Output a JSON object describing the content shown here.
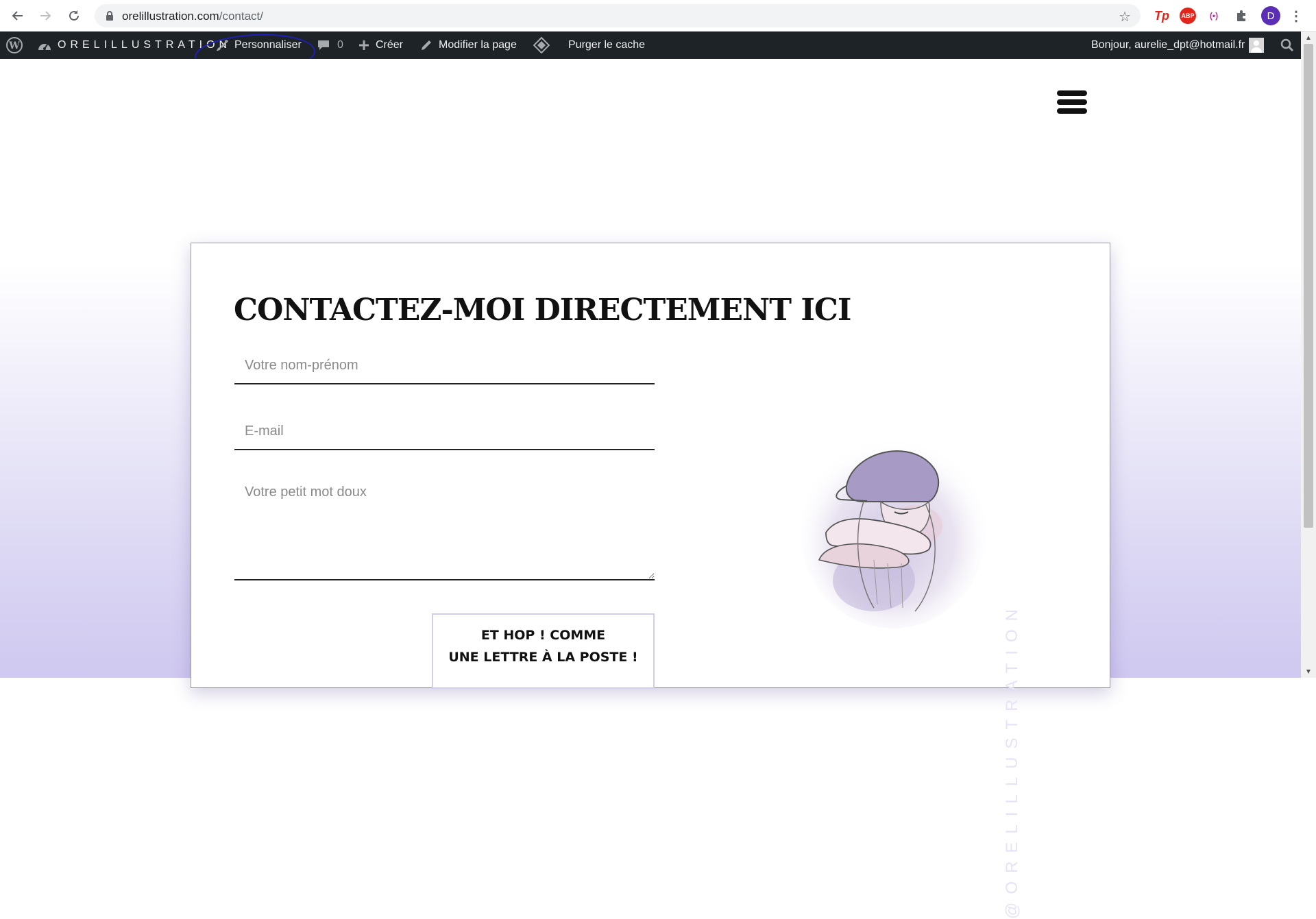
{
  "browser": {
    "url_domain": "orelillustration.com",
    "url_path": "/contact/",
    "extensions": [
      "Tp",
      "ABP",
      "(•)"
    ],
    "profile_initial": "D"
  },
  "adminbar": {
    "site_name": "ORELILLUSTRATION",
    "customize": "Personnaliser",
    "comments_count": "0",
    "create": "Créer",
    "edit_page": "Modifier la page",
    "purge_cache": "Purger le cache",
    "greeting": "Bonjour, aurelie_dpt@hotmail.fr"
  },
  "contact": {
    "title": "CONTACTEZ-MOI DIRECTEMENT ICI",
    "name_placeholder": "Votre nom-prénom",
    "email_placeholder": "E-mail",
    "message_placeholder": "Votre petit mot doux",
    "submit_line1": "ET HOP ! COMME",
    "submit_line2": "UNE LETTRE À LA POSTE !",
    "vertical_brand": "@ORELILLUSTRATION"
  },
  "colors": {
    "adminbar_bg": "#1d2327",
    "accent_lavender": "#cfc8f0",
    "annotation_circle": "#1f1fbf"
  }
}
